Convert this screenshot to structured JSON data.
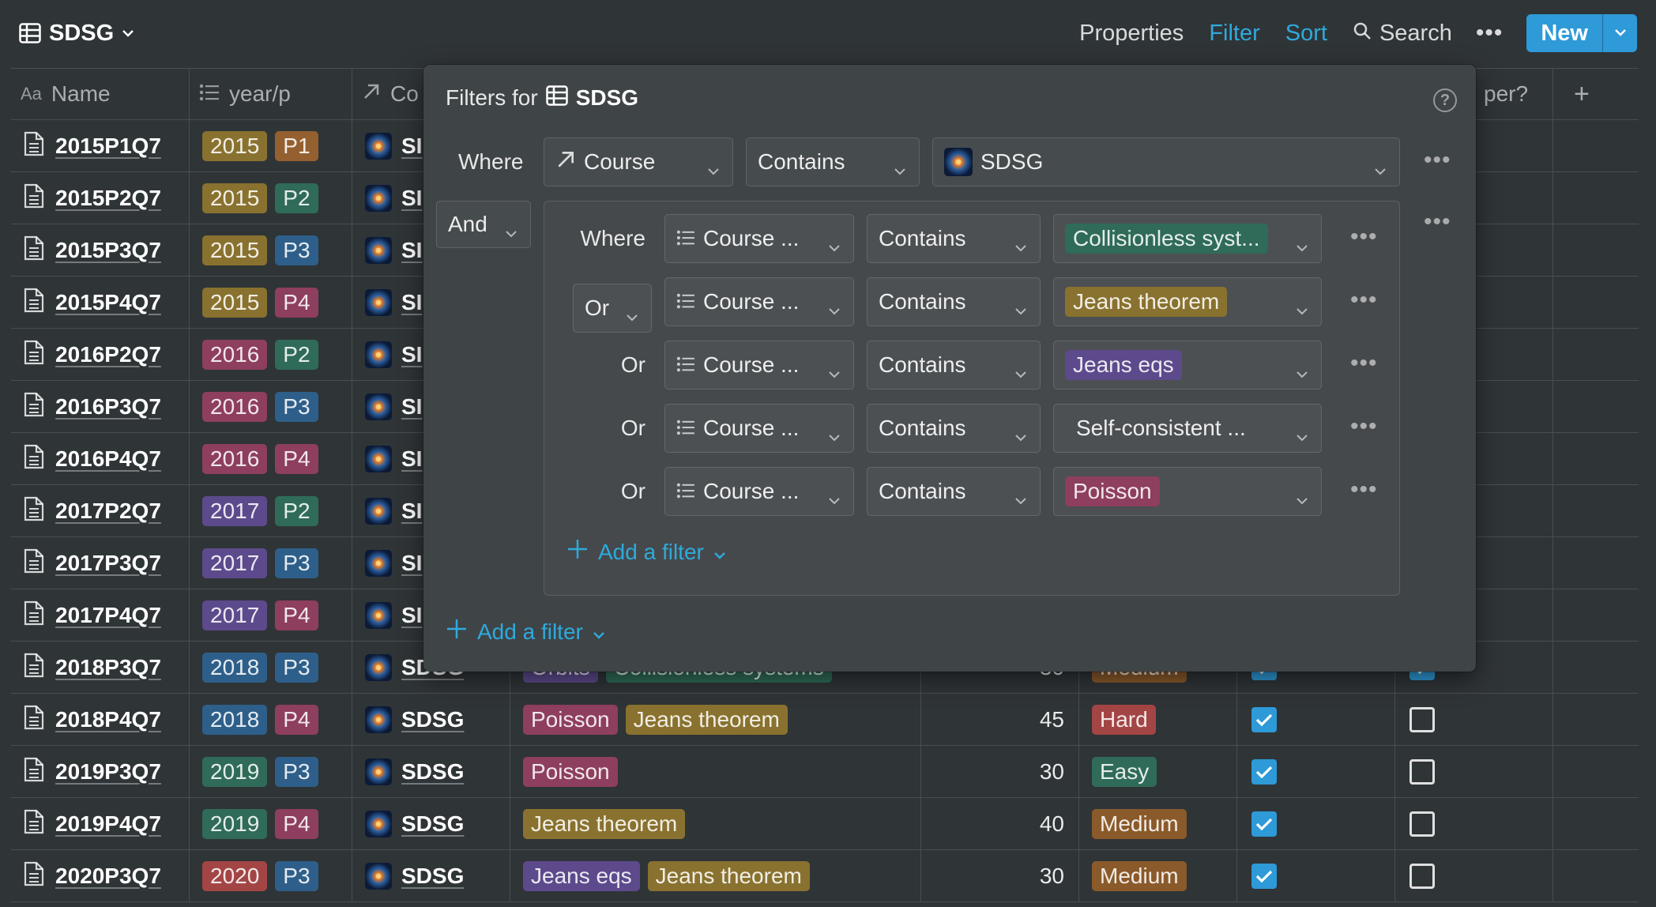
{
  "topbar": {
    "db_name": "SDSG",
    "properties": "Properties",
    "filter": "Filter",
    "sort": "Sort",
    "search": "Search",
    "more": "•••",
    "new_label": "New",
    "accent_color": "#2eaadc"
  },
  "columns": {
    "name": "Name",
    "year": "year/p",
    "course": "Co",
    "paper": "per?",
    "add": "+"
  },
  "rows": [
    {
      "name": "2015P1Q7",
      "year": "2015",
      "p": "P1",
      "course": "SI"
    },
    {
      "name": "2015P2Q7",
      "year": "2015",
      "p": "P2",
      "course": "SI"
    },
    {
      "name": "2015P3Q7",
      "year": "2015",
      "p": "P3",
      "course": "SI"
    },
    {
      "name": "2015P4Q7",
      "year": "2015",
      "p": "P4",
      "course": "SI"
    },
    {
      "name": "2016P2Q7",
      "year": "2016",
      "p": "P2",
      "course": "SI"
    },
    {
      "name": "2016P3Q7",
      "year": "2016",
      "p": "P3",
      "course": "SI"
    },
    {
      "name": "2016P4Q7",
      "year": "2016",
      "p": "P4",
      "course": "SI"
    },
    {
      "name": "2017P2Q7",
      "year": "2017",
      "p": "P2",
      "course": "SI"
    },
    {
      "name": "2017P3Q7",
      "year": "2017",
      "p": "P3",
      "course": "SI"
    },
    {
      "name": "2017P4Q7",
      "year": "2017",
      "p": "P4",
      "course": "SI"
    },
    {
      "name": "2018P3Q7",
      "year": "2018",
      "p": "P3",
      "course": "SDSG",
      "topics": [
        "Orbits",
        "Collisionless systems"
      ],
      "time": "30",
      "difficulty": "Medium",
      "done": true,
      "paper": true
    },
    {
      "name": "2018P4Q7",
      "year": "2018",
      "p": "P4",
      "course": "SDSG",
      "topics": [
        "Poisson",
        "Jeans theorem"
      ],
      "time": "45",
      "difficulty": "Hard",
      "done": true,
      "paper": false
    },
    {
      "name": "2019P3Q7",
      "year": "2019",
      "p": "P3",
      "course": "SDSG",
      "topics": [
        "Poisson"
      ],
      "time": "30",
      "difficulty": "Easy",
      "done": true,
      "paper": false
    },
    {
      "name": "2019P4Q7",
      "year": "2019",
      "p": "P4",
      "course": "SDSG",
      "topics": [
        "Jeans theorem"
      ],
      "time": "40",
      "difficulty": "Medium",
      "done": true,
      "paper": false
    },
    {
      "name": "2020P3Q7",
      "year": "2020",
      "p": "P3",
      "course": "SDSG",
      "topics": [
        "Jeans eqs",
        "Jeans theorem"
      ],
      "time": "30",
      "difficulty": "Medium",
      "done": true,
      "paper": false
    }
  ],
  "tag_colors": {
    "2015": "#89722f",
    "2016": "#8e3e5e",
    "2017": "#5d4a8c",
    "2018": "#2e5f8a",
    "2019": "#2f6b58",
    "2020": "#a34545",
    "P1": "#94602f",
    "P2": "#2f6b58",
    "P3": "#2e5f8a",
    "P4": "#8e3e5e",
    "Orbits": "#5d4a8c",
    "Collisionless systems": "#2f6b58",
    "Poisson": "#8e3e5e",
    "Jeans theorem": "#89722f",
    "Jeans eqs": "#5d4a8c",
    "Medium": "#8a5a2b",
    "Hard": "#a34545",
    "Easy": "#2f6b58"
  },
  "filter_popup": {
    "title_prefix": "Filters for",
    "db_name": "SDSG",
    "help": "?",
    "where": "Where",
    "property": "Course",
    "operator": "Contains",
    "value": "SDSG",
    "and": "And",
    "add_filter": "Add a filter",
    "group": {
      "rows": [
        {
          "conj": "Where",
          "property": "Course ...",
          "operator": "Contains",
          "value": "Collisionless syst...",
          "color": "#2f6b58"
        },
        {
          "conj": "Or",
          "property": "Course ...",
          "operator": "Contains",
          "value": "Jeans theorem",
          "color": "#89722f"
        },
        {
          "conj": "Or",
          "property": "Course ...",
          "operator": "Contains",
          "value": "Jeans eqs",
          "color": "#5d4a8c"
        },
        {
          "conj": "Or",
          "property": "Course ...",
          "operator": "Contains",
          "value": "Self-consistent ...",
          "color": ""
        },
        {
          "conj": "Or",
          "property": "Course ...",
          "operator": "Contains",
          "value": "Poisson",
          "color": "#8e3e5e"
        }
      ],
      "add_filter": "Add a filter"
    }
  }
}
